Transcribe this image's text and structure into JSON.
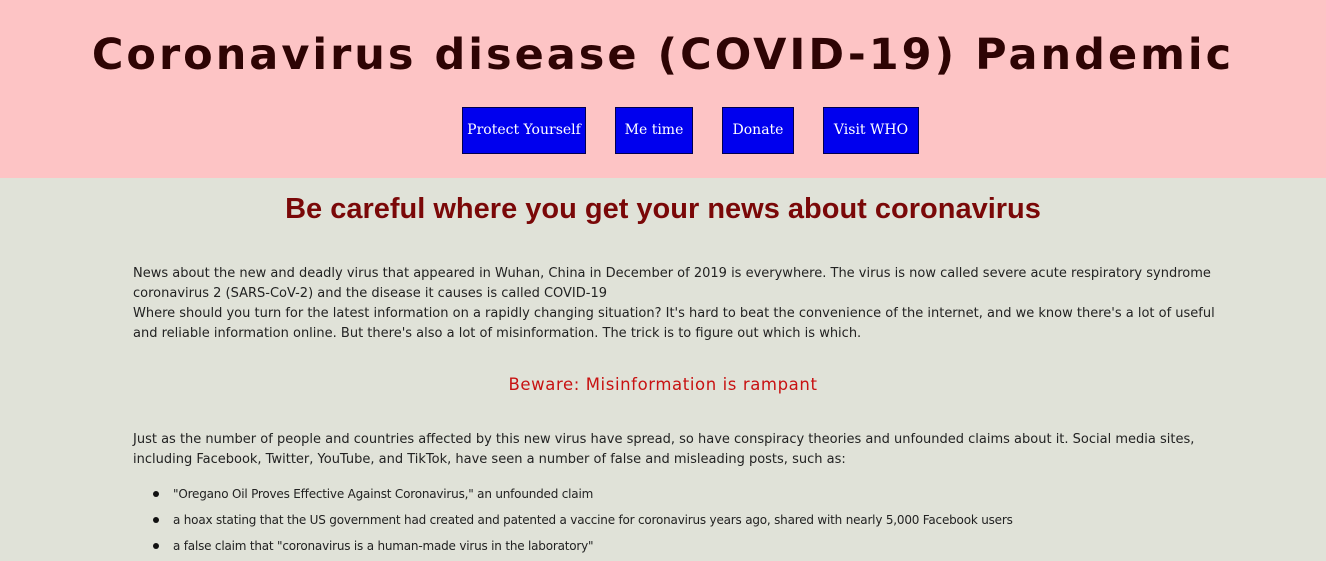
{
  "header": {
    "title": "Coronavirus disease (COVID-19) Pandemic",
    "nav": [
      {
        "label": "Protect Yourself"
      },
      {
        "label": "Me time"
      },
      {
        "label": "Donate"
      },
      {
        "label": "Visit WHO"
      }
    ]
  },
  "colors": {
    "header_bg": "#fdc4c5",
    "page_bg": "#e0e2d8",
    "nav_button_bg": "#0000ee",
    "headline": "#7a0808",
    "subhead": "#c81212"
  },
  "main": {
    "headline": "Be careful where you get your news about coronavirus",
    "intro": {
      "line1": "News about the new and deadly virus that appeared in Wuhan, China in December of 2019 is everywhere. The virus is now called severe acute respiratory syndrome coronavirus 2 (SARS-CoV-2) and the disease it causes is called COVID-19",
      "line2": "Where should you turn for the latest information on a rapidly changing situation? It's hard to beat the convenience of the internet, and we know there's a lot of useful and reliable information online. But there's also a lot of misinformation. The trick is to figure out which is which."
    },
    "subheading": "Beware: Misinformation is rampant",
    "misinfo_paragraph": "Just as the number of people and countries affected by this new virus have spread, so have conspiracy theories and unfounded claims about it. Social media sites, including Facebook, Twitter, YouTube, and TikTok, have seen a number of false and misleading posts, such as:",
    "claims": [
      "\"Oregano Oil Proves Effective Against Coronavirus,\" an unfounded claim",
      "a hoax stating that the US government had created and patented a vaccine for coronavirus years ago, shared with nearly 5,000 Facebook users",
      "a false claim that \"coronavirus is a human-made virus in the laboratory\""
    ]
  }
}
